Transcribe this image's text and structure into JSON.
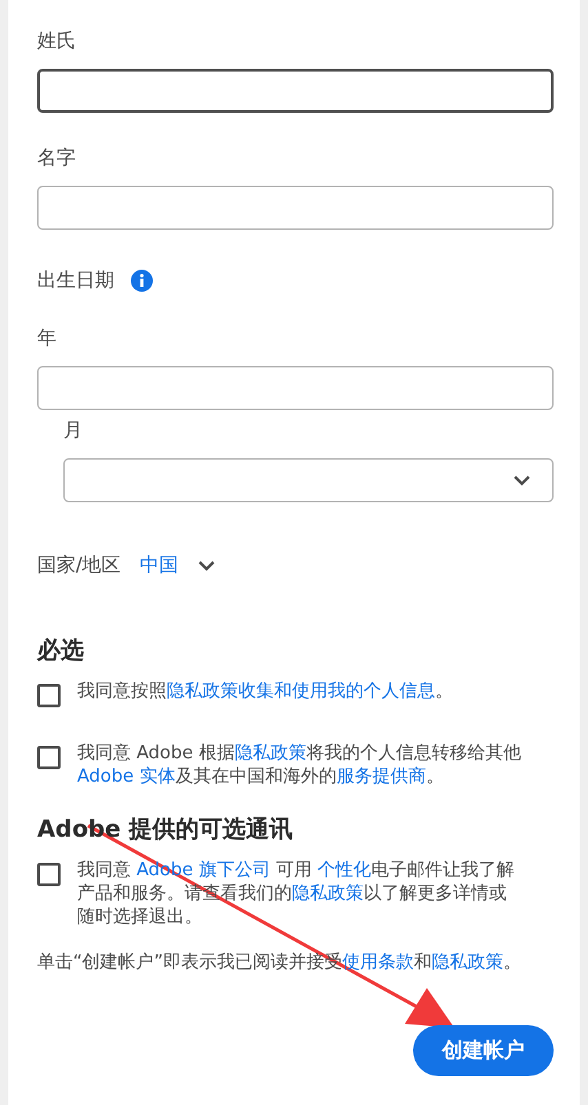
{
  "fields": [
    {
      "label": "姓氏",
      "focused": true
    },
    {
      "label": "名字",
      "focused": false
    }
  ],
  "birth_date": {
    "label": "出生日期",
    "year": {
      "label": "年"
    },
    "month": {
      "label": "月"
    }
  },
  "country": {
    "label": "国家/地区",
    "value": "中国"
  },
  "required": {
    "title": "必选",
    "items": [
      {
        "checked": false,
        "segments": [
          {
            "text": "我同意按照",
            "link": false
          },
          {
            "text": "隐私政策收集和使用我的个人信息",
            "link": true
          },
          {
            "text": "。",
            "link": false
          }
        ]
      },
      {
        "checked": false,
        "segments": [
          {
            "text": "我同意 Adobe 根据",
            "link": false
          },
          {
            "text": "隐私政策",
            "link": true
          },
          {
            "text": "将我的个人信息转移给其他 ",
            "link": false
          },
          {
            "text": "Adobe 实体",
            "link": true
          },
          {
            "text": "及其在中国和海外的",
            "link": false
          },
          {
            "text": "服务提供商",
            "link": true
          },
          {
            "text": "。",
            "link": false
          }
        ]
      }
    ]
  },
  "optional": {
    "title": "Adobe 提供的可选通讯",
    "items": [
      {
        "checked": false,
        "segments": [
          {
            "text": "我同意 ",
            "link": false
          },
          {
            "text": "Adobe 旗下公司",
            "link": true
          },
          {
            "text": " 可用 ",
            "link": false
          },
          {
            "text": "个性化",
            "link": true
          },
          {
            "text": "电子邮件让我了解产品和服务。请查看我们的",
            "link": false
          },
          {
            "text": "隐私政策",
            "link": true
          },
          {
            "text": "以了解更多详情或随时选择退出。",
            "link": false
          }
        ]
      }
    ]
  },
  "terms": {
    "segments": [
      {
        "text": "单击“创建帐户”即表示我已阅读并接受",
        "link": false
      },
      {
        "text": "使用条款",
        "link": true
      },
      {
        "text": "和",
        "link": false
      },
      {
        "text": "隐私政",
        "link": true
      },
      {
        "text": "策",
        "link": true
      },
      {
        "text": "。",
        "link": false
      }
    ]
  },
  "button": "创建帐户"
}
